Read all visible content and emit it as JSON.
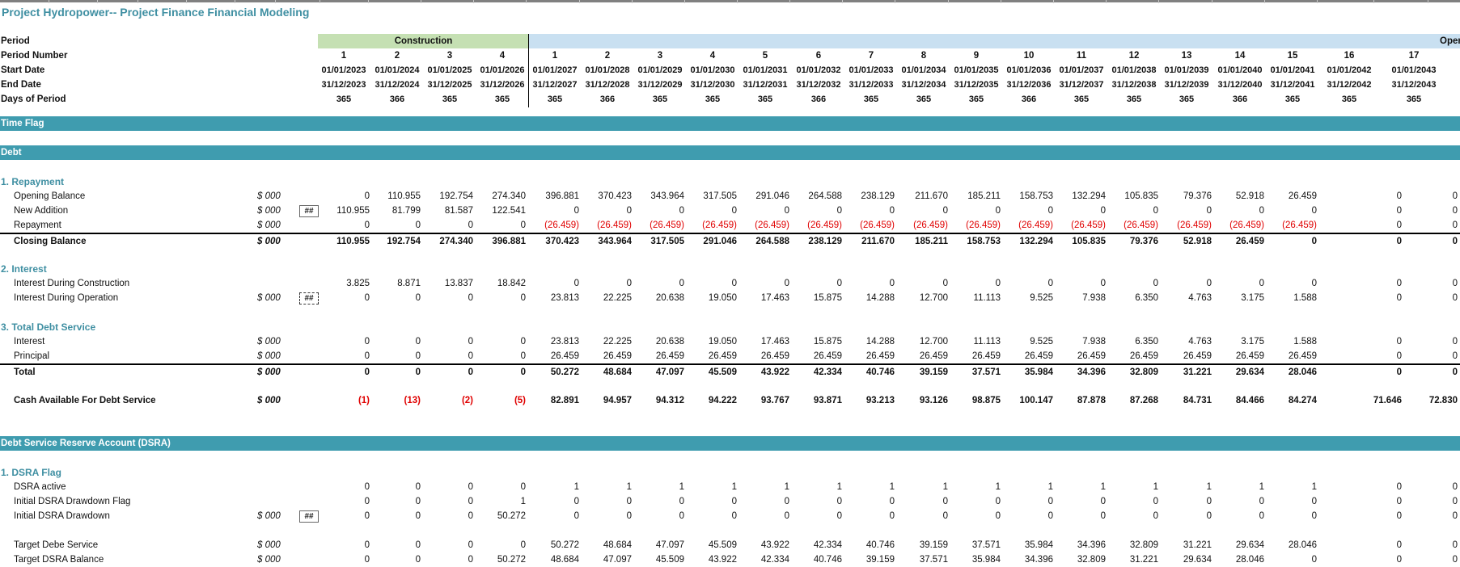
{
  "title": "Project Hydropower-- Project Finance Financial Modeling",
  "header": {
    "construction_label": "Construction",
    "operation_label": "Oper",
    "row_labels": {
      "period": "Period",
      "period_number": "Period Number",
      "start_date": "Start Date",
      "end_date": "End Date",
      "days": "Days of Period"
    },
    "period_numbers": [
      "1",
      "2",
      "3",
      "4",
      "1",
      "2",
      "3",
      "4",
      "5",
      "6",
      "7",
      "8",
      "9",
      "10",
      "11",
      "12",
      "13",
      "14",
      "15",
      "16",
      "17"
    ],
    "start_dates": [
      "01/01/2023",
      "01/01/2024",
      "01/01/2025",
      "01/01/2026",
      "01/01/2027",
      "01/01/2028",
      "01/01/2029",
      "01/01/2030",
      "01/01/2031",
      "01/01/2032",
      "01/01/2033",
      "01/01/2034",
      "01/01/2035",
      "01/01/2036",
      "01/01/2037",
      "01/01/2038",
      "01/01/2039",
      "01/01/2040",
      "01/01/2041",
      "01/01/2042",
      "01/01/2043"
    ],
    "end_dates": [
      "31/12/2023",
      "31/12/2024",
      "31/12/2025",
      "31/12/2026",
      "31/12/2027",
      "31/12/2028",
      "31/12/2029",
      "31/12/2030",
      "31/12/2031",
      "31/12/2032",
      "31/12/2033",
      "31/12/2034",
      "31/12/2035",
      "31/12/2036",
      "31/12/2037",
      "31/12/2038",
      "31/12/2039",
      "31/12/2040",
      "31/12/2041",
      "31/12/2042",
      "31/12/2043"
    ],
    "days": [
      "365",
      "366",
      "365",
      "365",
      "365",
      "366",
      "365",
      "365",
      "365",
      "366",
      "365",
      "365",
      "365",
      "366",
      "365",
      "365",
      "365",
      "366",
      "365",
      "365",
      "365"
    ]
  },
  "sections": {
    "time_flag": "Time Flag",
    "debt": "Debt",
    "dsra": "Debt Service Reserve Account (DSRA)"
  },
  "unit": "$ 000",
  "hash_text": "##",
  "repayment": {
    "title": "1. Repayment",
    "opening_label": "Opening Balance",
    "opening": [
      "0",
      "110.955",
      "192.754",
      "274.340",
      "396.881",
      "370.423",
      "343.964",
      "317.505",
      "291.046",
      "264.588",
      "238.129",
      "211.670",
      "185.211",
      "158.753",
      "132.294",
      "105.835",
      "79.376",
      "52.918",
      "26.459",
      "0",
      "0"
    ],
    "addition_label": "New Addition",
    "addition": [
      "110.955",
      "81.799",
      "81.587",
      "122.541",
      "0",
      "0",
      "0",
      "0",
      "0",
      "0",
      "0",
      "0",
      "0",
      "0",
      "0",
      "0",
      "0",
      "0",
      "0",
      "0",
      "0"
    ],
    "repay_label": "Repayment",
    "repay": [
      "0",
      "0",
      "0",
      "0",
      "(26.459)",
      "(26.459)",
      "(26.459)",
      "(26.459)",
      "(26.459)",
      "(26.459)",
      "(26.459)",
      "(26.459)",
      "(26.459)",
      "(26.459)",
      "(26.459)",
      "(26.459)",
      "(26.459)",
      "(26.459)",
      "(26.459)",
      "0",
      "0"
    ],
    "closing_label": "Closing Balance",
    "closing": [
      "110.955",
      "192.754",
      "274.340",
      "396.881",
      "370.423",
      "343.964",
      "317.505",
      "291.046",
      "264.588",
      "238.129",
      "211.670",
      "185.211",
      "158.753",
      "132.294",
      "105.835",
      "79.376",
      "52.918",
      "26.459",
      "0",
      "0",
      "0"
    ]
  },
  "interest": {
    "title": "2. Interest",
    "idc_label": "Interest During Construction",
    "idc": [
      "3.825",
      "8.871",
      "13.837",
      "18.842",
      "0",
      "0",
      "0",
      "0",
      "0",
      "0",
      "0",
      "0",
      "0",
      "0",
      "0",
      "0",
      "0",
      "0",
      "0",
      "0",
      "0"
    ],
    "ido_label": "Interest During Operation",
    "ido": [
      "0",
      "0",
      "0",
      "0",
      "23.813",
      "22.225",
      "20.638",
      "19.050",
      "17.463",
      "15.875",
      "14.288",
      "12.700",
      "11.113",
      "9.525",
      "7.938",
      "6.350",
      "4.763",
      "3.175",
      "1.588",
      "0",
      "0"
    ]
  },
  "tds": {
    "title": "3. Total Debt Service",
    "interest_label": "Interest",
    "interest": [
      "0",
      "0",
      "0",
      "0",
      "23.813",
      "22.225",
      "20.638",
      "19.050",
      "17.463",
      "15.875",
      "14.288",
      "12.700",
      "11.113",
      "9.525",
      "7.938",
      "6.350",
      "4.763",
      "3.175",
      "1.588",
      "0",
      "0"
    ],
    "principal_label": "Principal",
    "principal": [
      "0",
      "0",
      "0",
      "0",
      "26.459",
      "26.459",
      "26.459",
      "26.459",
      "26.459",
      "26.459",
      "26.459",
      "26.459",
      "26.459",
      "26.459",
      "26.459",
      "26.459",
      "26.459",
      "26.459",
      "26.459",
      "0",
      "0"
    ],
    "total_label": "Total",
    "total": [
      "0",
      "0",
      "0",
      "0",
      "50.272",
      "48.684",
      "47.097",
      "45.509",
      "43.922",
      "42.334",
      "40.746",
      "39.159",
      "37.571",
      "35.984",
      "34.396",
      "32.809",
      "31.221",
      "29.634",
      "28.046",
      "0",
      "0"
    ]
  },
  "cfads": {
    "label": "Cash Available For Debt Service",
    "values": [
      "(1)",
      "(13)",
      "(2)",
      "(5)",
      "82.891",
      "94.957",
      "94.312",
      "94.222",
      "93.767",
      "93.871",
      "93.213",
      "93.126",
      "98.875",
      "100.147",
      "87.878",
      "87.268",
      "84.731",
      "84.466",
      "84.274",
      "71.646",
      "72.830"
    ]
  },
  "dsra_flag": {
    "title": "1. DSRA Flag",
    "active_label": "DSRA active",
    "active": [
      "0",
      "0",
      "0",
      "0",
      "1",
      "1",
      "1",
      "1",
      "1",
      "1",
      "1",
      "1",
      "1",
      "1",
      "1",
      "1",
      "1",
      "1",
      "1",
      "0",
      "0"
    ],
    "initial_flag_label": "Initial DSRA Drawdown Flag",
    "initial_flag": [
      "0",
      "0",
      "0",
      "1",
      "0",
      "0",
      "0",
      "0",
      "0",
      "0",
      "0",
      "0",
      "0",
      "0",
      "0",
      "0",
      "0",
      "0",
      "0",
      "0",
      "0"
    ],
    "initial_drawdown_label": "Initial DSRA Drawdown",
    "initial_drawdown": [
      "0",
      "0",
      "0",
      "50.272",
      "0",
      "0",
      "0",
      "0",
      "0",
      "0",
      "0",
      "0",
      "0",
      "0",
      "0",
      "0",
      "0",
      "0",
      "0",
      "0",
      "0"
    ],
    "target_service_label": "Target Debe Service",
    "target_service": [
      "0",
      "0",
      "0",
      "0",
      "50.272",
      "48.684",
      "47.097",
      "45.509",
      "43.922",
      "42.334",
      "40.746",
      "39.159",
      "37.571",
      "35.984",
      "34.396",
      "32.809",
      "31.221",
      "29.634",
      "28.046",
      "0",
      "0"
    ],
    "target_balance_label": "Target DSRA Balance",
    "target_balance": [
      "0",
      "0",
      "0",
      "50.272",
      "48.684",
      "47.097",
      "45.509",
      "43.922",
      "42.334",
      "40.746",
      "39.159",
      "37.571",
      "35.984",
      "34.396",
      "32.809",
      "31.221",
      "29.634",
      "28.046",
      "0",
      "0",
      "0"
    ]
  }
}
